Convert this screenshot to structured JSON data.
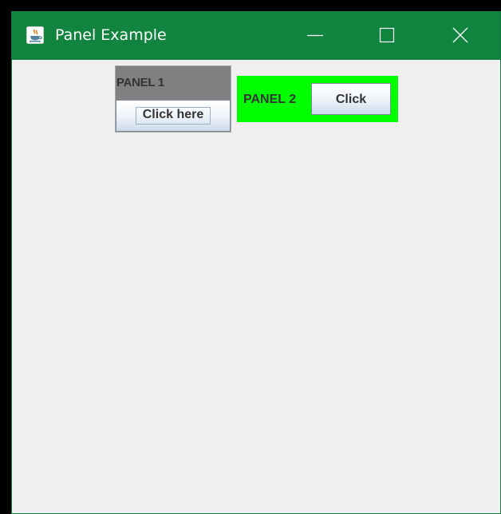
{
  "window": {
    "title": "Panel Example",
    "icon": "java-app-icon",
    "titlebar_color": "#11853f",
    "controls": {
      "minimize": "minimize-icon",
      "maximize": "maximize-icon",
      "close": "close-icon"
    }
  },
  "panel1": {
    "label": "PANEL 1",
    "header_color": "#808080",
    "button_label": "Click here"
  },
  "panel2": {
    "label": "PANEL 2",
    "background_color": "#00ff00",
    "button_label": "Click"
  },
  "content_background": "#f0f0f0"
}
